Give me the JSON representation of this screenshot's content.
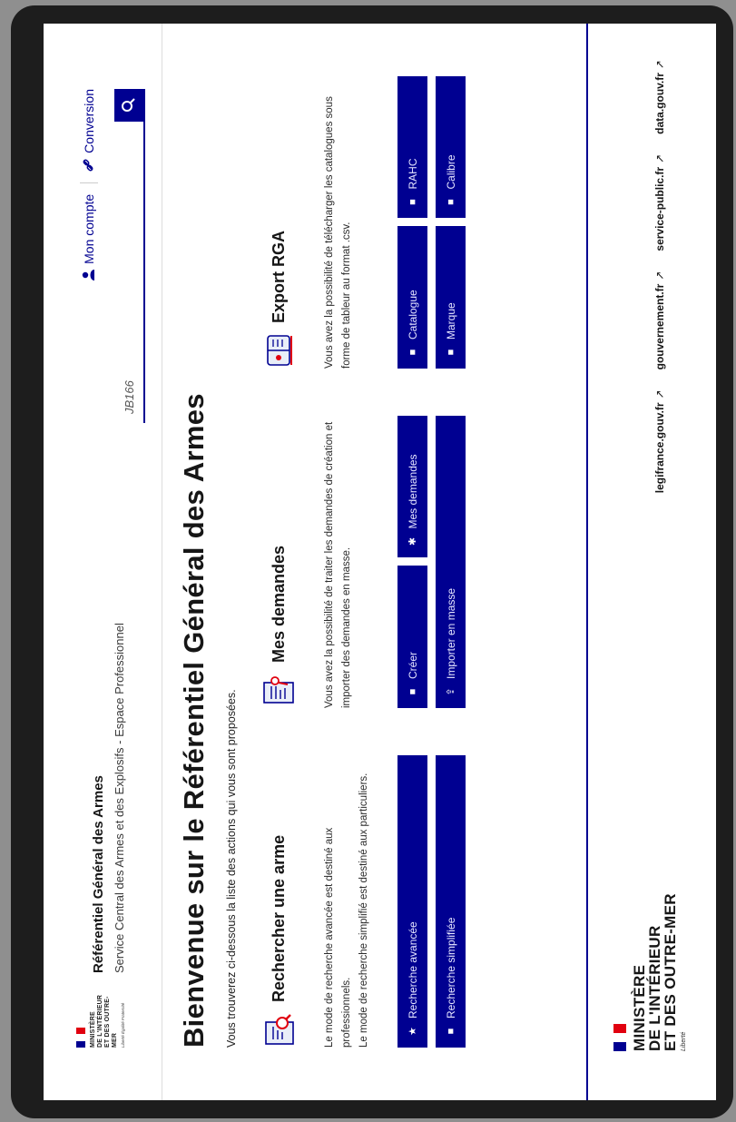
{
  "header": {
    "ministry_short": "MINISTÈRE\nDE L'INTÉRIEUR\nET DES OUTRE-MER",
    "motto": "Liberté Égalité Fraternité",
    "site_title": "Référentiel Général des Armes",
    "site_subtitle": "Service Central des Armes et des Explosifs - Espace Professionnel",
    "account_label": "Mon compte",
    "conversion_label": "Conversion",
    "search_value": "JB166"
  },
  "hero": {
    "title": "Bienvenue sur le Référentiel Général des Armes",
    "subtitle": "Vous trouverez ci-dessous la liste des actions qui vous sont proposées."
  },
  "sections": {
    "search": {
      "title": "Rechercher une arme",
      "text1": "Le mode de recherche avancée est destiné aux professionnels.",
      "text2": "Le mode de recherche simplifié est destiné aux particuliers.",
      "btn_advanced": "Recherche avancée",
      "btn_simple": "Recherche simplifiée"
    },
    "requests": {
      "title": "Mes demandes",
      "text": "Vous avez la possibilité de traiter les demandes de création et importer des demandes en masse.",
      "btn_create": "Créer",
      "btn_mine": "Mes demandes",
      "btn_import": "Importer en masse"
    },
    "export": {
      "title": "Export RGA",
      "text": "Vous avez la possibilité de télécharger les catalogues sous forme de tableur au format .csv.",
      "btn_catalogue": "Catalogue",
      "btn_rahc": "RAHC",
      "btn_marque": "Marque",
      "btn_calibre": "Calibre"
    }
  },
  "footer": {
    "ministry": "MINISTÈRE\nDE L'INTÉRIEUR\nET DES OUTRE-MER",
    "motto": "Liberté",
    "links": [
      "legifrance.gouv.fr",
      "gouvernement.fr",
      "service-public.fr",
      "data.gouv.fr"
    ]
  },
  "colors": {
    "primary": "#000091",
    "flag_red": "#e1000f"
  }
}
